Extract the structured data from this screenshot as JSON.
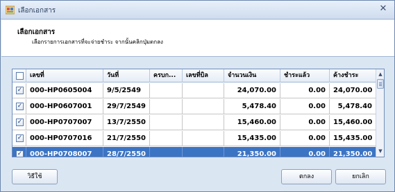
{
  "window": {
    "title": "เลือกเอกสาร",
    "close_glyph": "✕"
  },
  "header": {
    "title": "เลือกเอกสาร",
    "subtitle": "เลือกรายการเอกสารที่จะจ่ายชำระ จากนั้นคลิกปุ่มตกลง"
  },
  "grid": {
    "columns": [
      "เลขที่",
      "วันที่",
      "ครบก...",
      "เลขที่บิล",
      "จำนวนเงิน",
      "ชำระแล้ว",
      "ค้างชำระ"
    ],
    "rows": [
      {
        "checked": true,
        "number": "000-HP0605004",
        "date": "9/5/2549",
        "due": "",
        "bill": "",
        "amount": "24,070.00",
        "paid": "0.00",
        "outstanding": "24,070.00"
      },
      {
        "checked": true,
        "number": "000-HP0607001",
        "date": "29/7/2549",
        "due": "",
        "bill": "",
        "amount": "5,478.40",
        "paid": "0.00",
        "outstanding": "5,478.40"
      },
      {
        "checked": true,
        "number": "000-HP0707007",
        "date": "13/7/2550",
        "due": "",
        "bill": "",
        "amount": "15,460.00",
        "paid": "0.00",
        "outstanding": "15,460.00"
      },
      {
        "checked": true,
        "number": "000-HP0707016",
        "date": "21/7/2550",
        "due": "",
        "bill": "",
        "amount": "15,435.00",
        "paid": "0.00",
        "outstanding": "15,435.00"
      },
      {
        "checked": true,
        "number": "000-HP0708007",
        "date": "28/7/2550",
        "due": "",
        "bill": "",
        "amount": "21,350.00",
        "paid": "0.00",
        "outstanding": "21,350.00",
        "selected": true
      }
    ],
    "check_glyph": "✓"
  },
  "buttons": {
    "help": "วิธีใช้",
    "ok": "ตกลง",
    "cancel": "ยกเลิก"
  },
  "colors": {
    "selection": "#3c74c4",
    "titlebar": "#dbe6f3"
  },
  "icons": {
    "app": "app-icon",
    "close": "close-icon"
  }
}
